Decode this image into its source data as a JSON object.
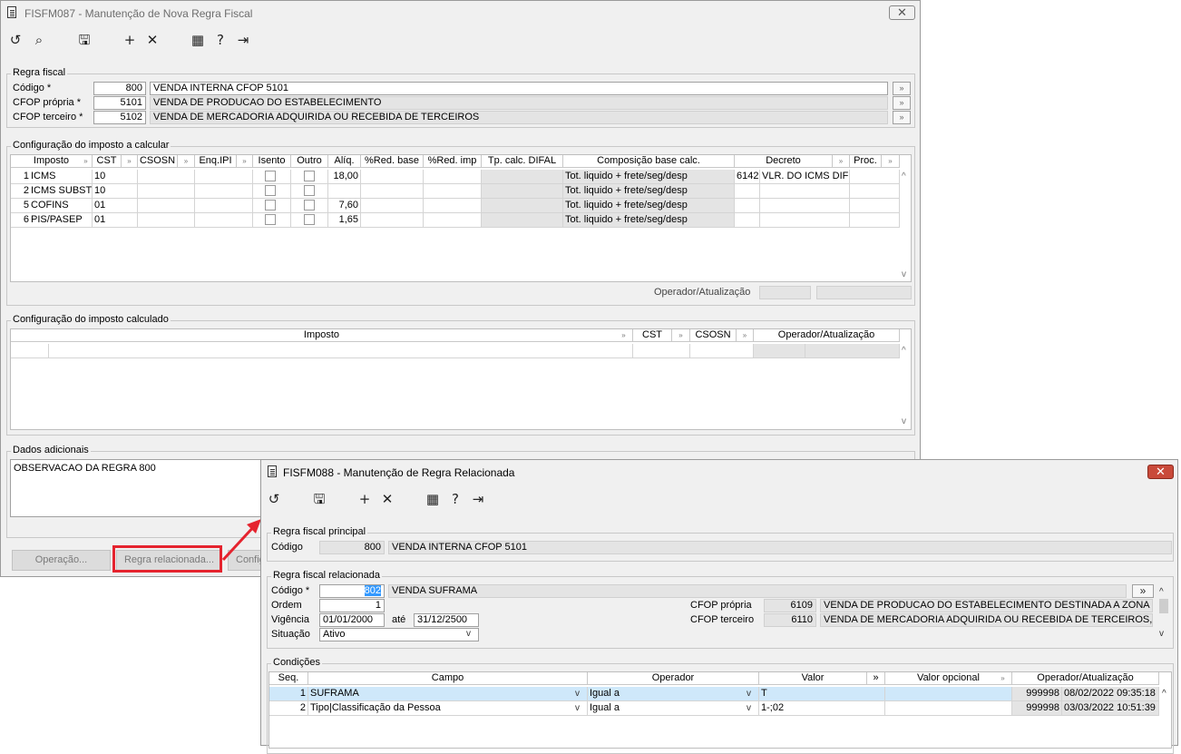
{
  "win1": {
    "title": "FISFM087 - Manutenção de Nova Regra Fiscal",
    "close": "✕",
    "regra": {
      "group": "Regra fiscal",
      "codigo_label": "Código *",
      "codigo": "800",
      "codigo_desc": "VENDA INTERNA CFOP 5101",
      "cfop_propria_label": "CFOP própria *",
      "cfop_propria": "5101",
      "cfop_propria_desc": "VENDA DE PRODUCAO DO ESTABELECIMENTO",
      "cfop_terceiro_label": "CFOP terceiro *",
      "cfop_terceiro": "5102",
      "cfop_terceiro_desc": "VENDA DE MERCADORIA ADQUIRIDA OU RECEBIDA DE TERCEIROS"
    },
    "config_calc": {
      "group": "Configuração do imposto a calcular",
      "headers": [
        "Imposto",
        "CST",
        "CSOSN",
        "Enq.IPI",
        "Isento",
        "Outro",
        "Alíq.",
        "%Red. base",
        "%Red. imp",
        "Tp. calc. DIFAL",
        "Composição base calc.",
        "Decreto",
        "Proc."
      ],
      "rows": [
        {
          "id": "1",
          "imposto": "ICMS",
          "cst": "10",
          "aliq": "18,00",
          "comp": "Tot. liquido + frete/seg/desp",
          "decreto_cod": "6142",
          "decreto_desc": "VLR. DO ICMS DIFE"
        },
        {
          "id": "2",
          "imposto": "ICMS SUBSTIT",
          "cst": "10",
          "aliq": "",
          "comp": "Tot. liquido + frete/seg/desp",
          "decreto_cod": "",
          "decreto_desc": ""
        },
        {
          "id": "5",
          "imposto": "COFINS",
          "cst": "01",
          "aliq": "7,60",
          "comp": "Tot. liquido + frete/seg/desp",
          "decreto_cod": "",
          "decreto_desc": ""
        },
        {
          "id": "6",
          "imposto": "PIS/PASEP",
          "cst": "01",
          "aliq": "1,65",
          "comp": "Tot. liquido + frete/seg/desp",
          "decreto_cod": "",
          "decreto_desc": ""
        }
      ],
      "operador_label": "Operador/Atualização"
    },
    "config_calculado": {
      "group": "Configuração do imposto calculado",
      "headers": [
        "Imposto",
        "CST",
        "CSOSN",
        "Operador/Atualização"
      ]
    },
    "dados": {
      "group": "Dados adicionais",
      "text": "OBSERVACAO DA REGRA 800"
    },
    "buttons": {
      "operacao": "Operação...",
      "regra_relacionada": "Regra relacionada...",
      "config": "Config"
    }
  },
  "win2": {
    "title": "FISFM088 - Manutenção de Regra Relacionada",
    "close": "✕",
    "principal": {
      "group": "Regra fiscal principal",
      "codigo_label": "Código",
      "codigo": "800",
      "codigo_desc": "VENDA INTERNA CFOP 5101"
    },
    "relacionada": {
      "group": "Regra fiscal relacionada",
      "codigo_label": "Código *",
      "codigo": "802",
      "codigo_desc": "VENDA SUFRAMA",
      "lookup": "»",
      "ordem_label": "Ordem",
      "ordem": "1",
      "vigencia_label": "Vigência",
      "vigencia_de": "01/01/2000",
      "ate_label": "até",
      "vigencia_ate": "31/12/2500",
      "situacao_label": "Situação",
      "situacao": "Ativo",
      "cfop_propria_label": "CFOP própria",
      "cfop_propria": "6109",
      "cfop_propria_desc": "VENDA DE PRODUCAO DO ESTABELECIMENTO DESTINADA A ZONA FRAN",
      "cfop_terceiro_label": "CFOP terceiro",
      "cfop_terceiro": "6110",
      "cfop_terceiro_desc": "VENDA DE MERCADORIA ADQUIRIDA OU RECEBIDA DE TERCEIROS, DESTIN"
    },
    "condicoes": {
      "group": "Condições",
      "headers": [
        "Seq.",
        "Campo",
        "Operador",
        "Valor",
        "Valor opcional",
        "Operador/Atualização"
      ],
      "valor_btn": "»",
      "rows": [
        {
          "seq": "1",
          "campo": "SUFRAMA",
          "operador": "Igual a",
          "valor": "T",
          "valor_opc": "",
          "user": "999998",
          "data": "08/02/2022 09:35:18"
        },
        {
          "seq": "2",
          "campo": "Tipo|Classificação da Pessoa",
          "operador": "Igual a",
          "valor": "1-;02",
          "valor_opc": "",
          "user": "999998",
          "data": "03/03/2022 10:51:39"
        }
      ]
    }
  },
  "accent_red": "#e5232e"
}
